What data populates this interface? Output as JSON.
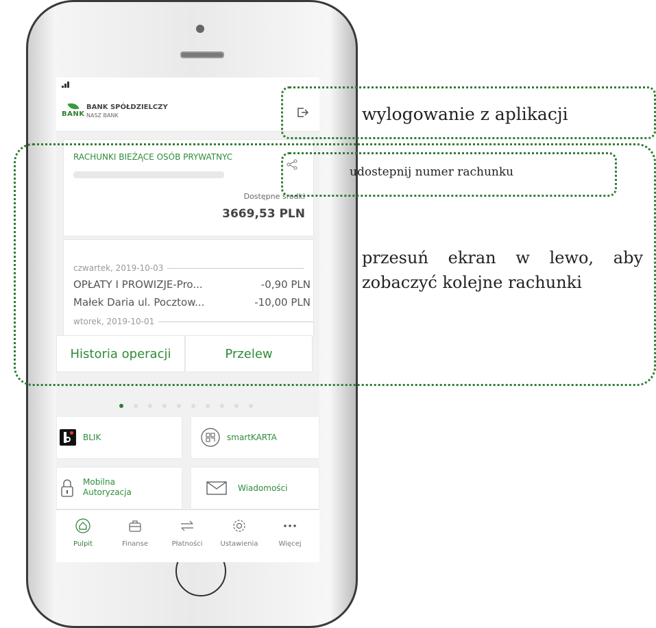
{
  "app": {
    "bank_name": "BANK SPÓŁDZIELCZY",
    "bank_sub": "NASZ BANK",
    "logo_word": "BANK"
  },
  "account": {
    "name": "RACHUNKI BIEŻĄCE OSÓB PRYWATNYC",
    "available_label": "Dostępne środki",
    "balance": "3669,53 PLN"
  },
  "history": {
    "date1": "czwartek, 2019-10-03",
    "transactions": [
      {
        "title": "OPŁATY I PROWIZJE-Pro...",
        "amount": "-0,90 PLN"
      },
      {
        "title": "Małek Daria  ul. Pocztow...",
        "amount": "-10,00 PLN"
      }
    ],
    "date2": "wtorek, 2019-10-01"
  },
  "tabs": {
    "history_label": "Historia operacji",
    "transfer_label": "Przelew"
  },
  "tiles": {
    "blik": "BLIK",
    "smartkarta": "smartKARTA",
    "mobile_auth": "Mobilna Autoryzacja",
    "messages": "Wiadomości"
  },
  "nav": [
    {
      "label": "Pulpit",
      "icon": "home-icon",
      "active": true
    },
    {
      "label": "Finanse",
      "icon": "briefcase-icon"
    },
    {
      "label": "Płatności",
      "icon": "transfer-arrows-icon"
    },
    {
      "label": "Ustawienia",
      "icon": "gear-icon"
    },
    {
      "label": "Więcej",
      "icon": "more-icon"
    }
  ],
  "annotations": {
    "logout": "wylogowanie z aplikacji",
    "share": "udostepnij numer rachunku",
    "swipe": "przesuń ekran w lewo, aby zobaczyć kolejne rachunki"
  },
  "colors": {
    "brand_green": "#2e8b3a",
    "annotation": "#2e7d32"
  },
  "carousel": {
    "pages": 10,
    "active_index": 0
  }
}
